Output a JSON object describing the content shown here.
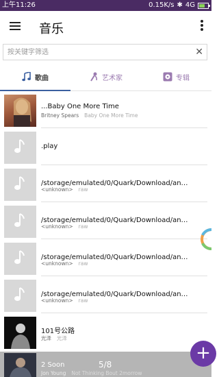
{
  "status": {
    "time": "上午11:26",
    "speed": "0.15K/s",
    "network": "4G"
  },
  "toolbar": {
    "title": "音乐"
  },
  "search": {
    "placeholder": "按关键字筛选",
    "value": ""
  },
  "tabs": [
    {
      "label": "歌曲",
      "selected": true
    },
    {
      "label": "艺术家",
      "selected": false
    },
    {
      "label": "专辑",
      "selected": false
    }
  ],
  "songs": [
    {
      "title": "...Baby One More Time",
      "artist": "Britney Spears",
      "album": "Baby One More Time",
      "art": "photo"
    },
    {
      "title": ".play",
      "artist": "",
      "album": "",
      "art": "note"
    },
    {
      "title": "/storage/emulated/0/Quark/Download/android编...",
      "artist": "<unknown>",
      "album": "raw",
      "art": "note"
    },
    {
      "title": "/storage/emulated/0/Quark/Download/android编...",
      "artist": "<unknown>",
      "album": "raw",
      "art": "note"
    },
    {
      "title": "/storage/emulated/0/Quark/Download/android编...",
      "artist": "<unknown>",
      "album": "raw",
      "art": "note"
    },
    {
      "title": "/storage/emulated/0/Quark/Download/android编...",
      "artist": "<unknown>",
      "album": "raw",
      "art": "note"
    },
    {
      "title": "101号公路",
      "artist": "光泽",
      "album": "光泽",
      "art": "dark"
    }
  ],
  "player": {
    "title": "2 Soon",
    "artist": "Jon Young",
    "album": "Not Thinking Bout 2morrow",
    "page": "5/8"
  },
  "colors": {
    "status_bar": "#4a2b63",
    "accent": "#6b3aa6",
    "tab_underline": "#3a5fa0"
  }
}
